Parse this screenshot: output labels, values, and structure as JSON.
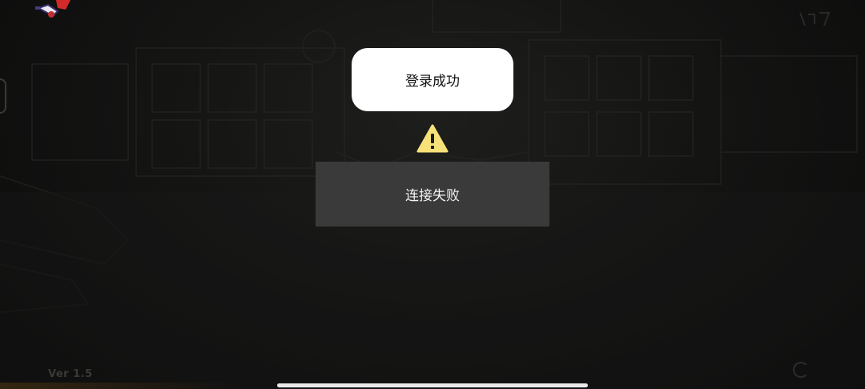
{
  "toast": {
    "message": "登录成功"
  },
  "error_dialog": {
    "icon": "warning-icon",
    "message": "连接失败"
  },
  "version": {
    "label": "Ver 1.5"
  },
  "icons": {
    "logo": "game-logo-icon",
    "loading": "loading-spinner-icon"
  },
  "colors": {
    "toast_background": "#ffffff",
    "error_background": "#3a3a3a",
    "warning_yellow": "#f7e27a"
  }
}
